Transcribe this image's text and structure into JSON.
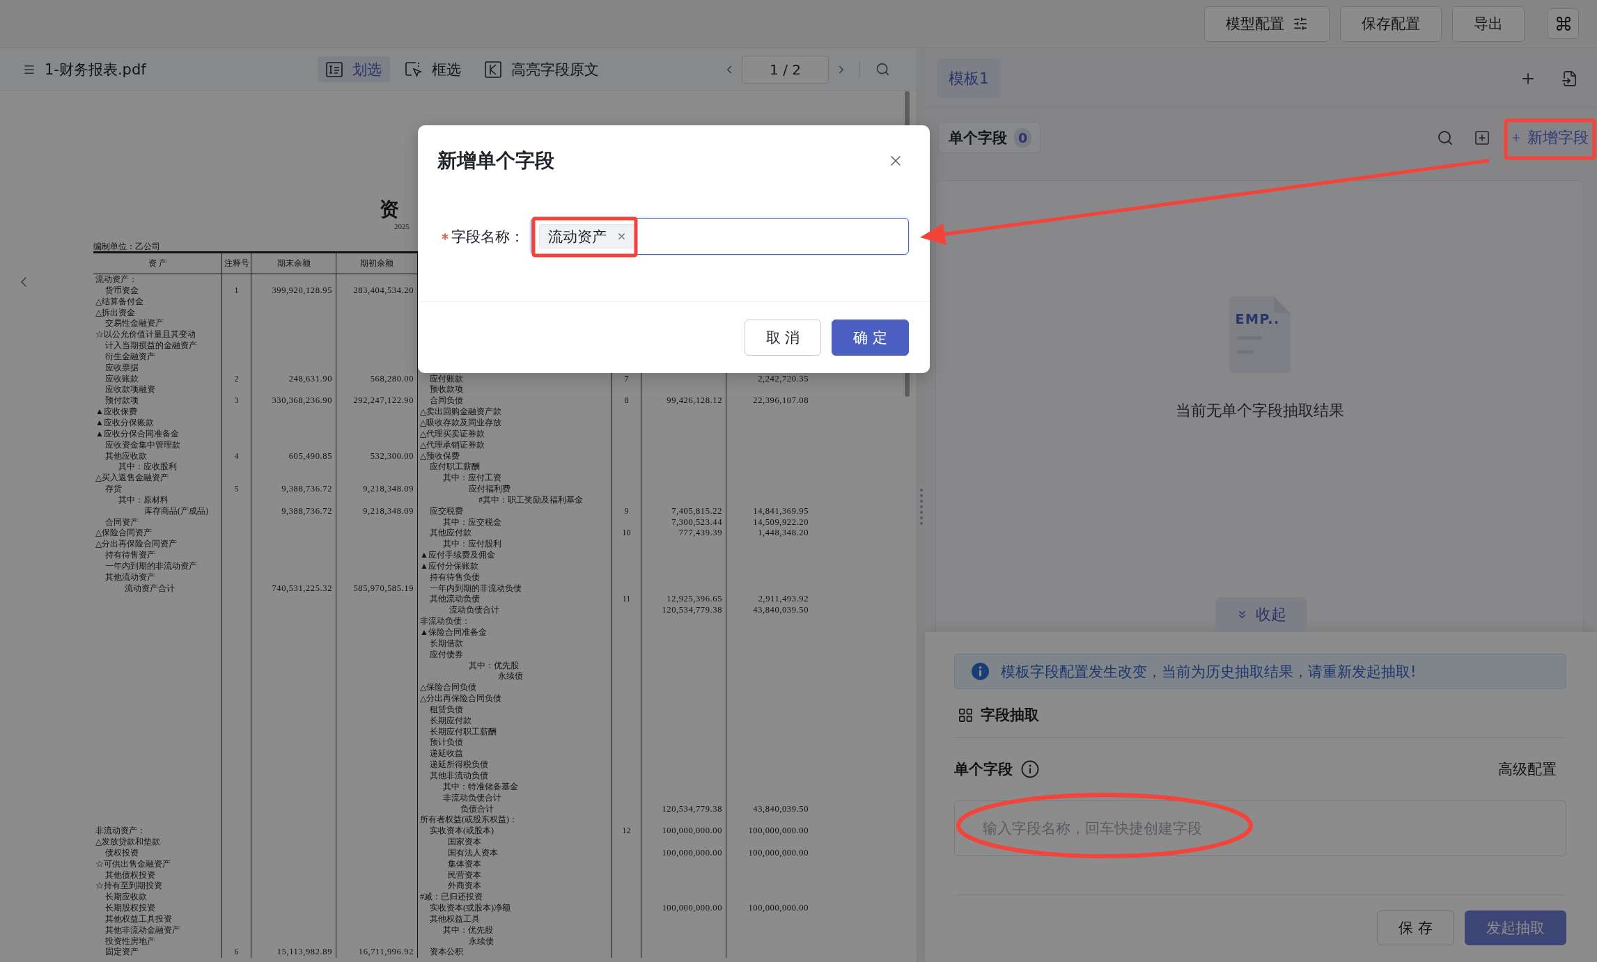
{
  "top_bar": {
    "buttons": [
      {
        "label": "模型配置",
        "kind": "with_icon"
      },
      {
        "label": "保存配置",
        "kind": "text"
      },
      {
        "label": "导出",
        "kind": "text"
      }
    ]
  },
  "viewer": {
    "file_name": "1-财务报表.pdf",
    "tools": [
      {
        "label": "划选",
        "selected": true
      },
      {
        "label": "框选",
        "selected": false
      },
      {
        "label": "高亮字段原文",
        "selected": false
      }
    ],
    "page_indicator": "1 / 2",
    "document": {
      "title": "资",
      "subtitle": "2025",
      "company": "编制单位：乙公司",
      "columns": [
        "资 产",
        "注释号",
        "期末余额",
        "期初余额"
      ],
      "rows": [
        {
          "left": {
            "label": "流动资产：",
            "kind": "heading"
          }
        },
        {
          "left": {
            "label": "货币资金",
            "kind": "item",
            "note": "1",
            "closing": "399,920,128.95",
            "opening": "283,404,534.20"
          }
        },
        {
          "left": {
            "label": "△结算备付金",
            "kind": "heading"
          }
        },
        {
          "left": {
            "label": "△拆出资金",
            "kind": "heading"
          }
        },
        {
          "left": {
            "label": "交易性金融资产",
            "kind": "item"
          }
        },
        {
          "left": {
            "label": "☆以公允价值计量且其变动",
            "kind": "heading"
          }
        },
        {
          "left": {
            "label": "计入当期损益的金融资产",
            "kind": "item"
          }
        },
        {
          "left": {
            "label": "衍生金融资产",
            "kind": "item"
          }
        },
        {
          "left": {
            "label": "应收票据",
            "kind": "item"
          }
        },
        {
          "left": {
            "label": "应收账款",
            "kind": "item",
            "note": "2",
            "closing": "248,631.90",
            "opening": "568,280.00"
          },
          "right": {
            "label": "应付账款",
            "kind": "item",
            "note": "7",
            "opening": "2,242,720.35"
          }
        },
        {
          "left": {
            "label": "应收款项融资",
            "kind": "item"
          },
          "right": {
            "label": "预收款项",
            "kind": "item"
          }
        },
        {
          "left": {
            "label": "预付款项",
            "kind": "item",
            "note": "3",
            "closing": "330,368,236.90",
            "opening": "292,247,122.90"
          },
          "right": {
            "label": "合同负债",
            "kind": "item",
            "note": "8",
            "closing": "99,426,128.12",
            "opening": "22,396,107.08"
          }
        },
        {
          "left": {
            "label": "▲应收保费",
            "kind": "heading"
          },
          "right": {
            "label": "△卖出回购金融资产款",
            "kind": "heading"
          }
        },
        {
          "left": {
            "label": "▲应收分保账款",
            "kind": "heading"
          },
          "right": {
            "label": "△吸收存款及同业存放",
            "kind": "heading"
          }
        },
        {
          "left": {
            "label": "▲应收分保合同准备金",
            "kind": "heading"
          },
          "right": {
            "label": "△代理买卖证券款",
            "kind": "heading"
          }
        },
        {
          "left": {
            "label": "应收资金集中管理款",
            "kind": "item"
          },
          "right": {
            "label": "△代理承销证券款",
            "kind": "heading"
          }
        },
        {
          "left": {
            "label": "其他应收款",
            "kind": "item",
            "note": "4",
            "closing": "605,490.85",
            "opening": "532,300.00"
          },
          "right": {
            "label": "△预收保费",
            "kind": "heading"
          }
        },
        {
          "left": {
            "label": "其中：应收股利",
            "kind": "sub_item"
          },
          "right": {
            "label": "应付职工薪酬",
            "kind": "item"
          }
        },
        {
          "left": {
            "label": "△买入返售金融资产",
            "kind": "heading"
          },
          "right": {
            "label": "其中：应付工资",
            "kind": "sub_item"
          }
        },
        {
          "left": {
            "label": "存货",
            "kind": "item",
            "note": "5",
            "closing": "9,388,736.72",
            "opening": "9,218,348.09"
          },
          "right": {
            "label": "应付福利费",
            "kind": "detail"
          }
        },
        {
          "left": {
            "label": "其中：原材料",
            "kind": "sub_item"
          },
          "right": {
            "label": "#其中：职工奖励及福利基金",
            "kind": "fine_print"
          }
        },
        {
          "left": {
            "label": "库存商品(产成品)",
            "kind": "detail",
            "closing": "9,388,736.72",
            "opening": "9,218,348.09"
          },
          "right": {
            "label": "应交税费",
            "kind": "item",
            "note": "9",
            "closing": "7,405,815.22",
            "opening": "14,841,369.95"
          }
        },
        {
          "left": {
            "label": "合同资产",
            "kind": "item"
          },
          "right": {
            "label": "其中：应交税金",
            "kind": "sub_item",
            "closing": "7,300,523.44",
            "opening": "14,509,922.20"
          }
        },
        {
          "left": {
            "label": "△保险合同资产",
            "kind": "heading"
          },
          "right": {
            "label": "其他应付款",
            "kind": "item",
            "note": "10",
            "closing": "777,439.39",
            "opening": "1,448,348.20"
          }
        },
        {
          "left": {
            "label": "△分出再保险合同资产",
            "kind": "heading"
          },
          "right": {
            "label": "其中：应付股利",
            "kind": "sub_item"
          }
        },
        {
          "left": {
            "label": "持有待售资产",
            "kind": "item"
          },
          "right": {
            "label": "▲应付手续费及佣金",
            "kind": "heading"
          }
        },
        {
          "left": {
            "label": "一年内到期的非流动资产",
            "kind": "item"
          },
          "right": {
            "label": "▲应付分保账款",
            "kind": "heading"
          }
        },
        {
          "left": {
            "label": "其他流动资产",
            "kind": "item"
          },
          "right": {
            "label": "持有待售负债",
            "kind": "item"
          }
        },
        {
          "left": {
            "label": "流动资产合计",
            "kind": "total",
            "closing": "740,531,225.32",
            "opening": "585,970,585.19"
          },
          "right": {
            "label": "一年内到期的非流动负债",
            "kind": "item"
          }
        },
        {
          "right": {
            "label": "其他流动负债",
            "kind": "item",
            "note": "11",
            "closing": "12,925,396.65",
            "opening": "2,911,493.92"
          }
        },
        {
          "right": {
            "label": "流动负债合计",
            "kind": "total",
            "closing": "120,534,779.38",
            "opening": "43,840,039.50"
          }
        },
        {
          "right": {
            "label": "非流动负债：",
            "kind": "heading"
          }
        },
        {
          "right": {
            "label": "▲保险合同准备金",
            "kind": "heading"
          }
        },
        {
          "right": {
            "label": "长期借款",
            "kind": "item"
          }
        },
        {
          "right": {
            "label": "应付债券",
            "kind": "item"
          }
        },
        {
          "right": {
            "label": "其中：优先股",
            "kind": "detail"
          }
        },
        {
          "right": {
            "label": "永续债",
            "kind": "trailing"
          }
        },
        {
          "right": {
            "label": "△保险合同负债",
            "kind": "heading"
          }
        },
        {
          "right": {
            "label": "△分出再保险合同负债",
            "kind": "heading"
          }
        },
        {
          "right": {
            "label": "租赁负债",
            "kind": "item"
          }
        },
        {
          "right": {
            "label": "长期应付款",
            "kind": "item"
          }
        },
        {
          "right": {
            "label": "长期应付职工薪酬",
            "kind": "item"
          }
        },
        {
          "right": {
            "label": "预计负债",
            "kind": "item"
          }
        },
        {
          "right": {
            "label": "递延收益",
            "kind": "item"
          }
        },
        {
          "right": {
            "label": "递延所得税负债",
            "kind": "item"
          }
        },
        {
          "right": {
            "label": "其他非流动负债",
            "kind": "item"
          }
        },
        {
          "right": {
            "label": "其中：特准储备基金",
            "kind": "sub_item"
          }
        },
        {
          "right": {
            "label": "非流动负债合计",
            "kind": "sub_item"
          }
        },
        {
          "right": {
            "label": "负债合计",
            "kind": "grand_total",
            "closing": "120,534,779.38",
            "opening": "43,840,039.50"
          }
        },
        {
          "right": {
            "label": "所有者权益(或股东权益)：",
            "kind": "heading"
          }
        },
        {
          "left": {
            "label": "非流动资产：",
            "kind": "heading"
          },
          "right": {
            "label": "实收资本(或股本)",
            "kind": "item",
            "note": "12",
            "closing": "100,000,000.00",
            "opening": "100,000,000.00"
          }
        },
        {
          "left": {
            "label": "△发放贷款和垫款",
            "kind": "heading"
          },
          "right": {
            "label": "国家资本",
            "kind": "member"
          }
        },
        {
          "left": {
            "label": "债权投资",
            "kind": "item"
          },
          "right": {
            "label": "国有法人资本",
            "kind": "member",
            "closing": "100,000,000.00",
            "opening": "100,000,000.00"
          }
        },
        {
          "left": {
            "label": "☆可供出售金融资产",
            "kind": "heading"
          },
          "right": {
            "label": "集体资本",
            "kind": "member"
          }
        },
        {
          "left": {
            "label": "其他债权投资",
            "kind": "item"
          },
          "right": {
            "label": "民营资本",
            "kind": "member"
          }
        },
        {
          "left": {
            "label": "☆持有至到期投资",
            "kind": "heading"
          },
          "right": {
            "label": "外商资本",
            "kind": "member"
          }
        },
        {
          "left": {
            "label": "长期应收款",
            "kind": "item"
          },
          "right": {
            "label": "#减：已归还投资",
            "kind": "heading"
          }
        },
        {
          "left": {
            "label": "长期股权投资",
            "kind": "item"
          },
          "right": {
            "label": "实收资本(或股本)净额",
            "kind": "item",
            "closing": "100,000,000.00",
            "opening": "100,000,000.00"
          }
        },
        {
          "left": {
            "label": "其他权益工具投资",
            "kind": "item"
          },
          "right": {
            "label": "其他权益工具",
            "kind": "item"
          }
        },
        {
          "left": {
            "label": "其他非流动金融资产",
            "kind": "item"
          },
          "right": {
            "label": "其中：优先股",
            "kind": "sub_item"
          }
        },
        {
          "left": {
            "label": "投资性房地产",
            "kind": "item"
          },
          "right": {
            "label": "永续债",
            "kind": "detail"
          }
        },
        {
          "left": {
            "label": "固定资产",
            "kind": "item",
            "note": "6",
            "closing": "15,113,982.89",
            "opening": "16,711,996.92"
          },
          "right": {
            "label": "资本公积",
            "kind": "item"
          }
        }
      ]
    }
  },
  "template_panel": {
    "tabs": [
      {
        "label": "模板1",
        "selected": true
      }
    ],
    "section": {
      "label": "单个字段",
      "count": "0"
    },
    "add_link": "新增字段",
    "empty_state": {
      "art_text": "EMP..",
      "message": "当前无单个字段抽取结果"
    },
    "collapse_label": "收起"
  },
  "extraction_panel": {
    "notice": "模板字段配置发生改变，当前为历史抽取结果，请重新发起抽取!",
    "heading": "字段抽取",
    "field_label": "单个字段",
    "advanced_link": "高级配置",
    "input_placeholder": "输入字段名称，回车快捷创建字段",
    "buttons": [
      {
        "label": "保 存",
        "kind": "default",
        "disabled": false
      },
      {
        "label": "发起抽取",
        "kind": "primary",
        "disabled": true
      }
    ]
  },
  "dialog": {
    "title": "新增单个字段",
    "field": {
      "label": "字段名称：",
      "required": true,
      "tags": [
        {
          "label": "流动资产"
        }
      ]
    },
    "buttons": [
      {
        "label": "取 消",
        "kind": "default"
      },
      {
        "label": "确 定",
        "kind": "primary"
      }
    ]
  }
}
